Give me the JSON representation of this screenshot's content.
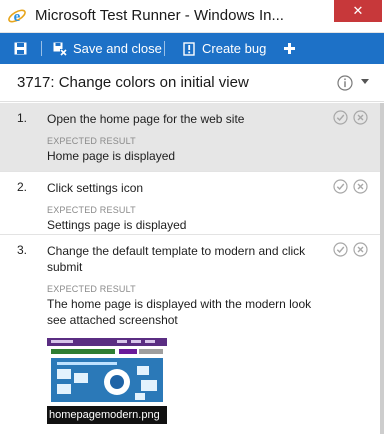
{
  "window": {
    "title": "Microsoft Test Runner - Windows In...",
    "close_glyph": "✕",
    "icon": "internet-explorer-icon"
  },
  "toolbar": {
    "save_icon": "floppy-disk-icon",
    "save_close_label": "Save and close",
    "create_bug_label": "Create bug",
    "add_icon": "plus-icon",
    "bg_color": "#1d71c7"
  },
  "test_case": {
    "title": "3717: Change colors on initial view"
  },
  "steps": [
    {
      "number": "1.",
      "action": "Open the home page for the web site",
      "expected_label": "EXPECTED RESULT",
      "expected": "Home page is displayed",
      "selected": true
    },
    {
      "number": "2.",
      "action": "Click settings icon",
      "expected_label": "EXPECTED RESULT",
      "expected": "Settings page is displayed",
      "selected": false
    },
    {
      "number": "3.",
      "action": "Change the default template to modern and click submit",
      "expected_label": "EXPECTED RESULT",
      "expected": "The home page is displayed with the modern look see attached screenshot",
      "selected": false,
      "attachment": {
        "file_name": "homepagemodern.png"
      }
    }
  ],
  "colors": {
    "close_button": "#c7383a",
    "selected_row": "#e6e6e6"
  }
}
